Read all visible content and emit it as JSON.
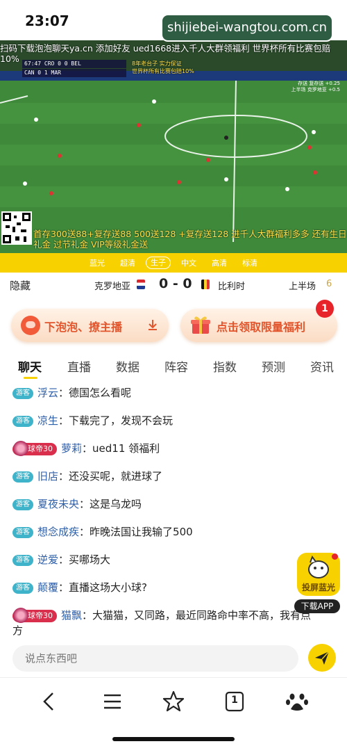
{
  "status_bar": {
    "time": "23:07"
  },
  "watermark": "shijiebei-wangtou.com.cn",
  "video": {
    "ticker_top_line1": "扫码下载泡泡聊天ya.cn 添加好友 ued1668进入千人大群领福利 世界杯所有比赛包赔",
    "ticker_top_line2": "10%",
    "scoreboard": {
      "row1": "67:47 CRO 0 0 BEL",
      "row2": "CAN 0 1 MAR"
    },
    "promo_yellow_line1": "8年老台子 实力保证",
    "promo_yellow_line2": "世界杯所有比赛包赔10%",
    "promo_right_line1": "存送  复存送 +0.25",
    "promo_right_line2": "上半场  克罗地亚 +0.5",
    "bottom_ticker": "首存300送88+复存送88 500送128 +复存送128 进千人大群福利多多 还有生日礼金 过节礼金 VIP等级礼金送"
  },
  "quality": {
    "items": [
      "蓝光",
      "超清",
      "生子",
      "中文",
      "高清",
      "标清"
    ],
    "active_index": 2
  },
  "match": {
    "hide_label": "隐藏",
    "team_left": "克罗地亚",
    "score": "0 - 0",
    "team_right": "比利时",
    "period": "上半场",
    "period_num": "6"
  },
  "actions": {
    "left_label": "下泡泡、撩主播",
    "right_label": "点击领取限量福利",
    "badge": "1"
  },
  "tabs": [
    "聊天",
    "直播",
    "数据",
    "阵容",
    "指数",
    "预测",
    "资讯"
  ],
  "chat": {
    "guest_tag": "游客",
    "vip_tag": "球帝30",
    "messages": [
      {
        "user": "浮云",
        "text": "德国怎么看呢"
      },
      {
        "user": "凉生",
        "text": "下载完了，发现不会玩"
      },
      {
        "user": "萝莉",
        "text": "ued11 领福利"
      },
      {
        "user": "旧店",
        "text": "还没买呢，就进球了"
      },
      {
        "user": "夏夜未央",
        "text": "这是乌龙吗"
      },
      {
        "user": "想念成疾",
        "text": "昨晚法国让我输了500"
      },
      {
        "user": "逆爱",
        "text": "买哪场大"
      },
      {
        "user": "颠覆",
        "text": "直播这场大小球?"
      },
      {
        "user": "猫飘",
        "text": "大猫猫，又同路，最近同路命中率不高，我有点方"
      }
    ]
  },
  "cast": {
    "label": "投屏蓝光",
    "download": "下载APP"
  },
  "input": {
    "placeholder": "说点东西吧"
  },
  "browser_nav": {
    "tab_count": "1",
    "icons": [
      "back-icon",
      "menu-icon",
      "star-icon",
      "tabs-icon",
      "paw-icon"
    ]
  },
  "colors": {
    "accent": "#f8d200",
    "orange": "#e2542b",
    "guest": "#3fb3c9",
    "vip": "#d92f4c"
  }
}
